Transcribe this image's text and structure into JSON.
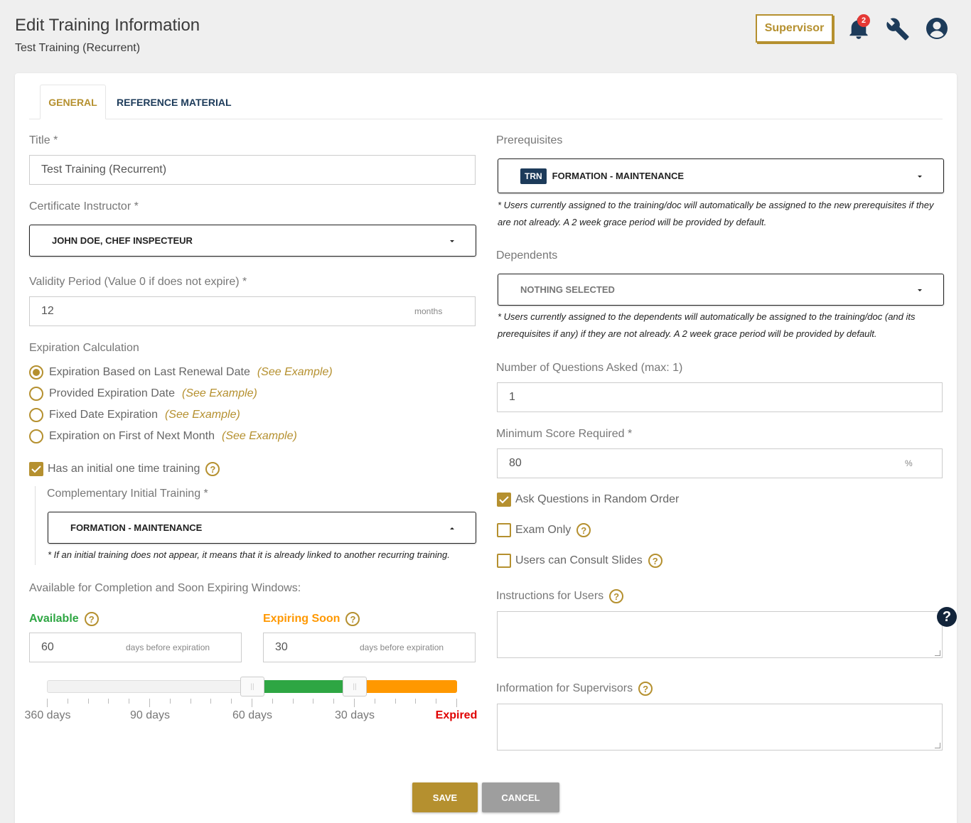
{
  "header": {
    "title": "Edit Training Information",
    "subtitle": "Test Training (Recurrent)",
    "role_button": "Supervisor",
    "notification_count": "2",
    "icons": [
      "bell-icon",
      "wrench-icon",
      "user-circle-icon"
    ]
  },
  "tabs": [
    {
      "label": "GENERAL",
      "active": true
    },
    {
      "label": "REFERENCE MATERIAL",
      "active": false
    }
  ],
  "left": {
    "title_label": "Title *",
    "title_value": "Test Training (Recurrent)",
    "instructor_label": "Certificate Instructor *",
    "instructor_value": "JOHN DOE, CHEF INSPECTEUR",
    "validity_label": "Validity Period (Value 0 if does not expire) *",
    "validity_value": "12",
    "validity_suffix": "months",
    "expiration_label": "Expiration Calculation",
    "expiration_options": [
      {
        "label": "Expiration Based on Last Renewal Date",
        "example": "(See Example)",
        "checked": true
      },
      {
        "label": "Provided Expiration Date",
        "example": "(See Example)",
        "checked": false
      },
      {
        "label": "Fixed Date Expiration",
        "example": "(See Example)",
        "checked": false
      },
      {
        "label": "Expiration on First of Next Month",
        "example": "(See Example)",
        "checked": false
      }
    ],
    "initial_training_label": "Has an initial one time training",
    "initial_training_checked": true,
    "complementary_label": "Complementary Initial Training *",
    "complementary_value": "FORMATION - MAINTENANCE",
    "complementary_note": "* If an initial training does not appear, it means that it is already linked to another recurring training.",
    "windows_label": "Available for Completion and Soon Expiring Windows:",
    "available_label": "Available",
    "available_value": "60",
    "expiring_label": "Expiring Soon",
    "expiring_value": "30",
    "days_suffix": "days before expiration",
    "slider": {
      "scale_days": 360,
      "available_days": 60,
      "expiring_days": 30,
      "tick_labels": [
        "360 days",
        "90 days",
        "60 days",
        "30 days",
        "Expired"
      ],
      "colors": {
        "available": "#2ea643",
        "expiring": "#ff9800",
        "expired": "#e00000"
      }
    }
  },
  "right": {
    "prereq_label": "Prerequisites",
    "prereq_tag": "TRN",
    "prereq_value": "FORMATION - MAINTENANCE",
    "prereq_note": "* Users currently assigned to the training/doc will automatically be assigned to the new prerequisites if they are not already. A 2 week grace period will be provided by default.",
    "dependents_label": "Dependents",
    "dependents_value": "NOTHING SELECTED",
    "dependents_note": "* Users currently assigned to the dependents will automatically be assigned to the training/doc (and its prerequisites if any) if they are not already. A 2 week grace period will be provided by default.",
    "questions_label": "Number of Questions Asked (max: 1)",
    "questions_value": "1",
    "score_label": "Minimum Score Required *",
    "score_value": "80",
    "score_suffix": "%",
    "random_label": "Ask Questions in Random Order",
    "random_checked": true,
    "exam_label": "Exam Only",
    "exam_checked": false,
    "slides_label": "Users can Consult Slides",
    "slides_checked": false,
    "instructions_label": "Instructions for Users",
    "supervisors_label": "Information for Supervisors"
  },
  "buttons": {
    "save": "SAVE",
    "cancel": "CANCEL"
  },
  "colors": {
    "accent": "#b5902f",
    "navy": "#1d3b5a",
    "background": "#efefef",
    "cancel_gray": "#9e9e9e"
  }
}
